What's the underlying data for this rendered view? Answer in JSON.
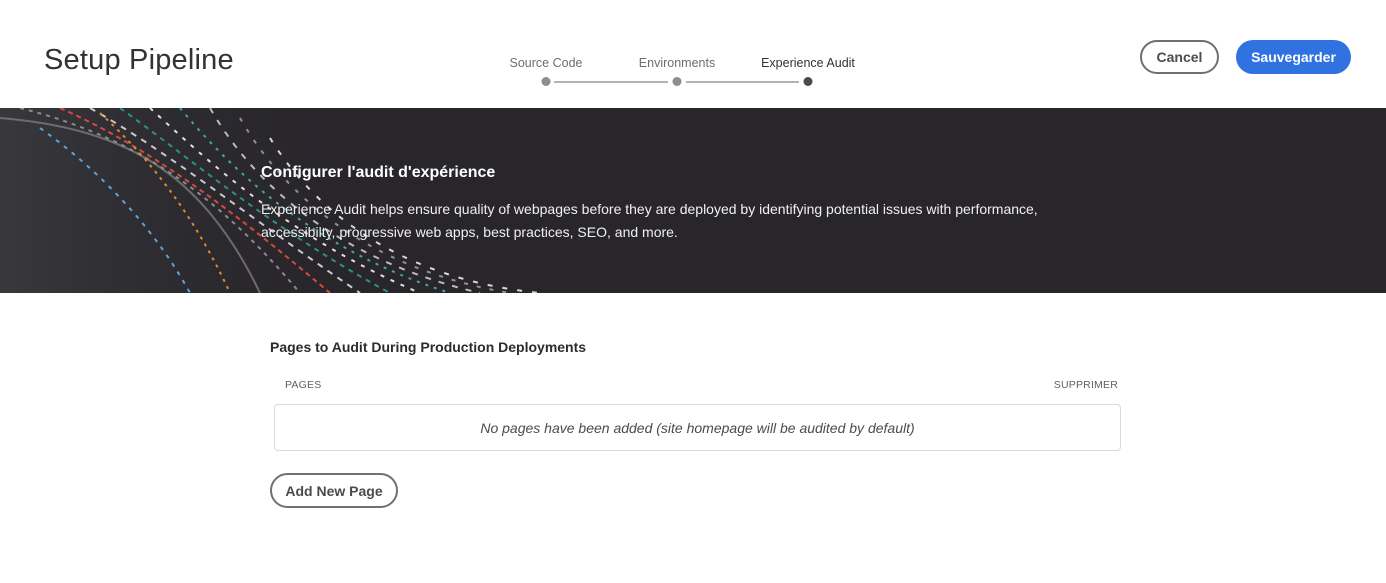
{
  "header": {
    "title": "Setup Pipeline",
    "steps": [
      {
        "label": "Source Code"
      },
      {
        "label": "Environments"
      },
      {
        "label": "Experience Audit"
      }
    ],
    "cancel_label": "Cancel",
    "save_label": "Sauvegarder",
    "save_color": "#2f72e0"
  },
  "banner": {
    "title": "Configurer l'audit d'expérience",
    "description": "Experience Audit helps ensure quality of webpages before they are deployed by identifying potential issues with performance, accessibilty, progressive web apps, best practices, SEO, and more.",
    "background_color": "#28262b"
  },
  "main": {
    "section_title": "Pages to Audit During Production Deployments",
    "table": {
      "columns": [
        "PAGES",
        "SUPPRIMER"
      ],
      "empty_message": "No pages have been added (site homepage will be audited by default)"
    },
    "add_page_label": "Add New Page"
  }
}
